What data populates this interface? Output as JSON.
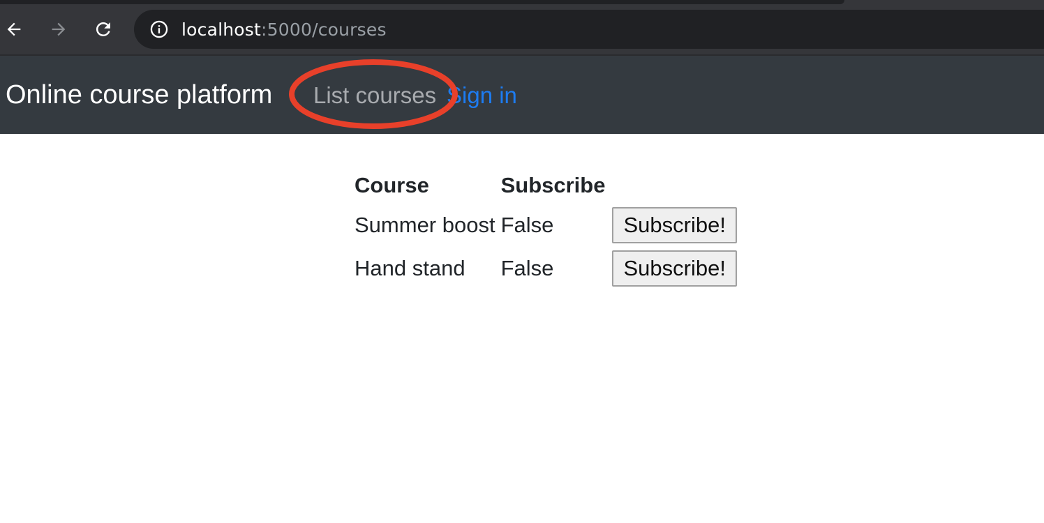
{
  "browser": {
    "url_host": "localhost",
    "url_rest": ":5000/courses"
  },
  "navbar": {
    "brand": "Online course platform",
    "links": [
      {
        "label": "List courses"
      },
      {
        "label": "Sign in"
      }
    ],
    "annotation_color": "#e8402a"
  },
  "table": {
    "headers": [
      "Course",
      "Subscribe",
      ""
    ],
    "rows": [
      {
        "course": "Summer boost",
        "subscribed": "False",
        "action": "Subscribe!"
      },
      {
        "course": "Hand stand",
        "subscribed": "False",
        "action": "Subscribe!"
      }
    ]
  }
}
